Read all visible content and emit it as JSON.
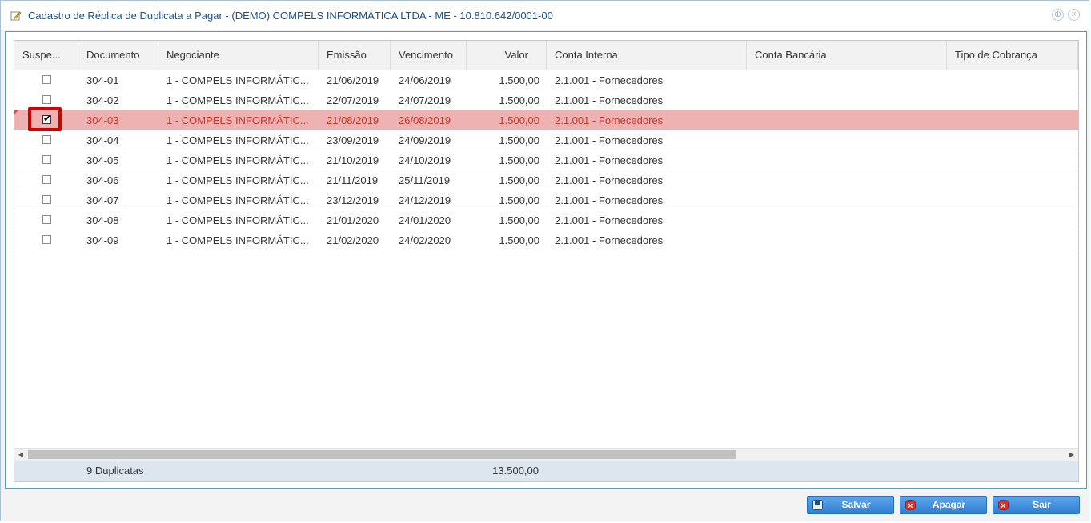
{
  "window": {
    "title": "Cadastro de Réplica de Duplicata a Pagar - (DEMO) COMPELS INFORMÁTICA LTDA - ME - 10.810.642/0001-00",
    "title_icon": "pencil-edit-icon",
    "controls": [
      "maximize-icon",
      "close-icon"
    ]
  },
  "grid": {
    "columns": [
      "Suspe...",
      "Documento",
      "Negociante",
      "Emissão",
      "Vencimento",
      "Valor",
      "Conta Interna",
      "Conta Bancária",
      "Tipo de Cobrança"
    ],
    "rows": [
      {
        "suspended": false,
        "documento": "304-01",
        "negociante": "1 - COMPELS INFORMÁTIC...",
        "emissao": "21/06/2019",
        "vencimento": "24/06/2019",
        "valor": "1.500,00",
        "conta_interna": "2.1.001 - Fornecedores",
        "conta_bancaria": "",
        "tipo_cobranca": ""
      },
      {
        "suspended": false,
        "documento": "304-02",
        "negociante": "1 - COMPELS INFORMÁTIC...",
        "emissao": "22/07/2019",
        "vencimento": "24/07/2019",
        "valor": "1.500,00",
        "conta_interna": "2.1.001 - Fornecedores",
        "conta_bancaria": "",
        "tipo_cobranca": ""
      },
      {
        "suspended": true,
        "documento": "304-03",
        "negociante": "1 - COMPELS INFORMÁTIC...",
        "emissao": "21/08/2019",
        "vencimento": "26/08/2019",
        "valor": "1.500,00",
        "conta_interna": "2.1.001 - Fornecedores",
        "conta_bancaria": "",
        "tipo_cobranca": ""
      },
      {
        "suspended": false,
        "documento": "304-04",
        "negociante": "1 - COMPELS INFORMÁTIC...",
        "emissao": "23/09/2019",
        "vencimento": "24/09/2019",
        "valor": "1.500,00",
        "conta_interna": "2.1.001 - Fornecedores",
        "conta_bancaria": "",
        "tipo_cobranca": ""
      },
      {
        "suspended": false,
        "documento": "304-05",
        "negociante": "1 - COMPELS INFORMÁTIC...",
        "emissao": "21/10/2019",
        "vencimento": "24/10/2019",
        "valor": "1.500,00",
        "conta_interna": "2.1.001 - Fornecedores",
        "conta_bancaria": "",
        "tipo_cobranca": ""
      },
      {
        "suspended": false,
        "documento": "304-06",
        "negociante": "1 - COMPELS INFORMÁTIC...",
        "emissao": "21/11/2019",
        "vencimento": "25/11/2019",
        "valor": "1.500,00",
        "conta_interna": "2.1.001 - Fornecedores",
        "conta_bancaria": "",
        "tipo_cobranca": ""
      },
      {
        "suspended": false,
        "documento": "304-07",
        "negociante": "1 - COMPELS INFORMÁTIC...",
        "emissao": "23/12/2019",
        "vencimento": "24/12/2019",
        "valor": "1.500,00",
        "conta_interna": "2.1.001 - Fornecedores",
        "conta_bancaria": "",
        "tipo_cobranca": ""
      },
      {
        "suspended": false,
        "documento": "304-08",
        "negociante": "1 - COMPELS INFORMÁTIC...",
        "emissao": "21/01/2020",
        "vencimento": "24/01/2020",
        "valor": "1.500,00",
        "conta_interna": "2.1.001 - Fornecedores",
        "conta_bancaria": "",
        "tipo_cobranca": ""
      },
      {
        "suspended": false,
        "documento": "304-09",
        "negociante": "1 - COMPELS INFORMÁTIC...",
        "emissao": "21/02/2020",
        "vencimento": "24/02/2020",
        "valor": "1.500,00",
        "conta_interna": "2.1.001 - Fornecedores",
        "conta_bancaria": "",
        "tipo_cobranca": ""
      }
    ],
    "footer": {
      "count_label": "9 Duplicatas",
      "total_valor": "13.500,00"
    }
  },
  "buttons": {
    "save_label": "Salvar",
    "delete_label": "Apagar",
    "exit_label": "Sair"
  },
  "colors": {
    "selected_row_bg": "#efb2b2",
    "selected_row_text": "#c0392b",
    "title_text": "#15508f",
    "button_blue": "#2f7fd3",
    "highlight_box": "#d40000"
  }
}
